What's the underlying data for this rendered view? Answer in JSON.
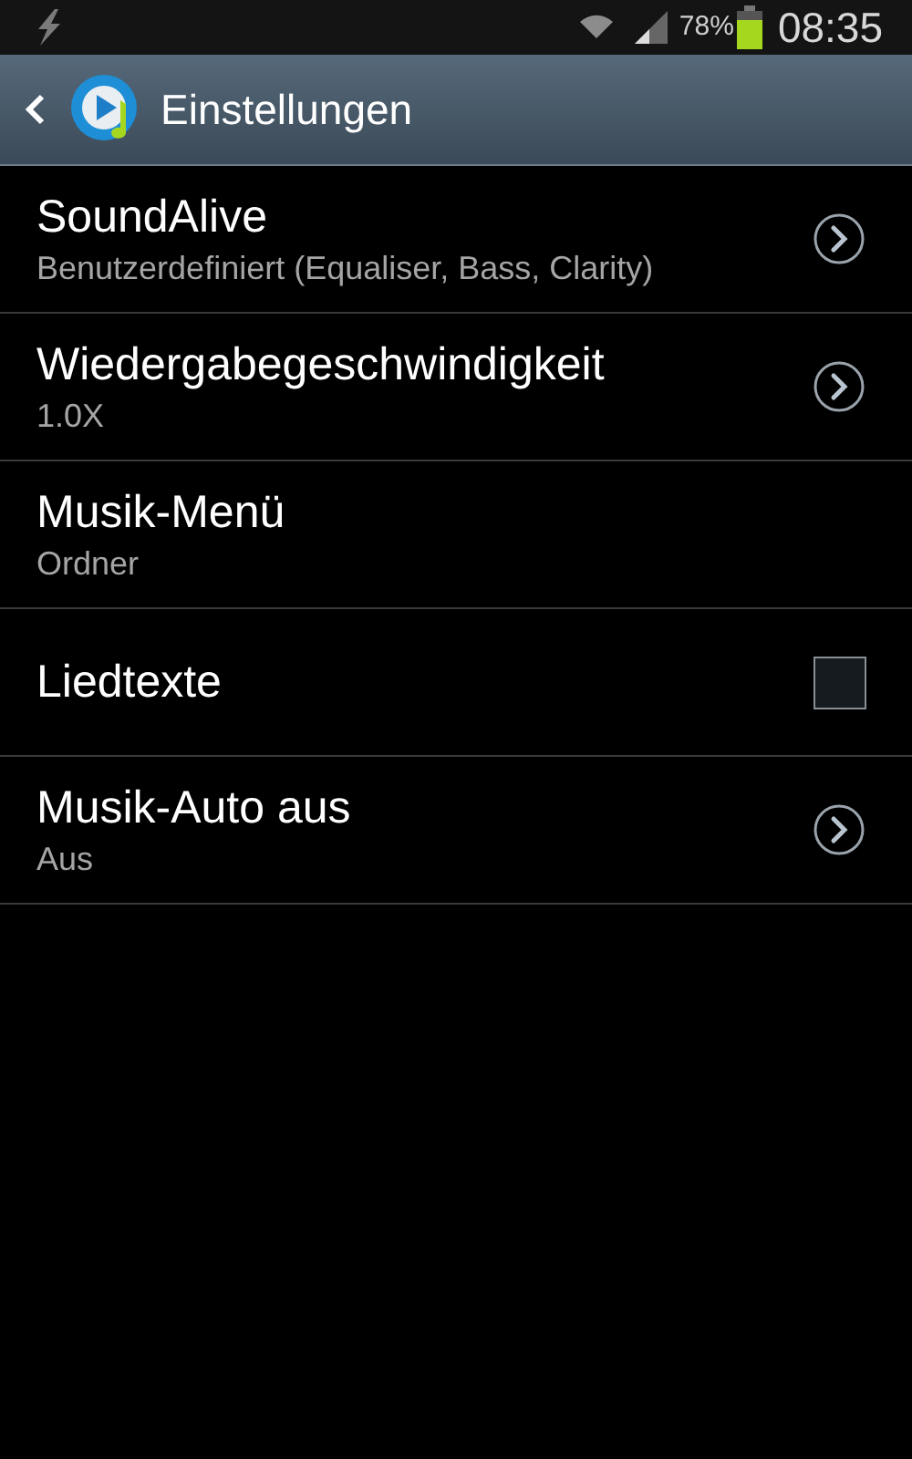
{
  "status_bar": {
    "battery": "78%",
    "time": "08:35"
  },
  "header": {
    "title": "Einstellungen"
  },
  "settings": [
    {
      "kind": "link",
      "title": "SoundAlive",
      "subtitle": "Benutzerdefiniert (Equaliser, Bass, Clarity)"
    },
    {
      "kind": "link",
      "title": "Wiedergabegeschwindigkeit",
      "subtitle": "1.0X"
    },
    {
      "kind": "plain",
      "title": "Musik-Menü",
      "subtitle": "Ordner"
    },
    {
      "kind": "checkbox",
      "title": "Liedtexte",
      "checked": false
    },
    {
      "kind": "link",
      "title": "Musik-Auto aus",
      "subtitle": "Aus"
    }
  ]
}
